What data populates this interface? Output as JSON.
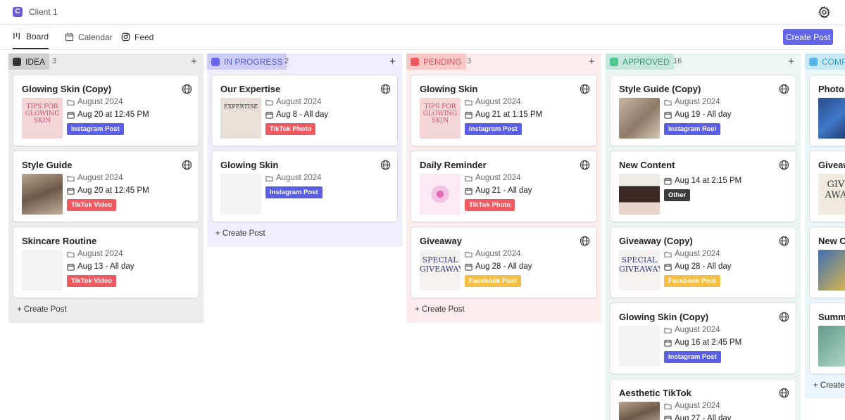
{
  "header": {
    "client_initial": "C",
    "client_name": "Client 1"
  },
  "nav": {
    "tabs": [
      {
        "label": "Board",
        "active": true
      },
      {
        "label": "Calendar",
        "active": false
      },
      {
        "label": "Feed",
        "active": false
      }
    ],
    "create_post": "Create Post"
  },
  "colors": {
    "accent": "#6366e8",
    "idea": "#333333",
    "in_progress": "#6b67e8",
    "pending": "#ee5a61",
    "approved": "#4ec894",
    "complete": "#55b7e6"
  },
  "columns": [
    {
      "title": "IDEA",
      "count": "3",
      "cards": [
        {
          "title": "Glowing Skin (Copy)",
          "folder": "August 2024",
          "date": "Aug 20 at 12:45 PM",
          "tag": "Instagram Post",
          "thumb_text": "TIPS FOR GLOWING SKIN"
        },
        {
          "title": "Style Guide",
          "folder": "August 2024",
          "date": "Aug 20 at 12:45 PM",
          "tag": "TikTok Video"
        },
        {
          "title": "Skincare Routine",
          "folder": "August 2024",
          "date": "Aug 13 - All day",
          "tag": "TikTok Video"
        }
      ],
      "create_label": "+ Create Post"
    },
    {
      "title": "IN PROGRESS",
      "count": "2",
      "cards": [
        {
          "title": "Our Expertise",
          "folder": "August 2024",
          "date": "Aug 8 - All day",
          "tag": "TikTok Photo",
          "thumb_text": "EXPERTISE"
        },
        {
          "title": "Glowing Skin",
          "folder": "August 2024",
          "tag": "Instagram Post"
        }
      ],
      "create_label": "+ Create Post"
    },
    {
      "title": "PENDING",
      "count": "3",
      "cards": [
        {
          "title": "Glowing Skin",
          "folder": "August 2024",
          "date": "Aug 21 at 1:15 PM",
          "tag": "Instagram Post",
          "thumb_text": "TIPS FOR GLOWING SKIN"
        },
        {
          "title": "Daily Reminder",
          "folder": "August 2024",
          "date": "Aug 21 - All day",
          "tag": "TikTok Photo"
        },
        {
          "title": "Giveaway",
          "folder": "August 2024",
          "date": "Aug 28 - All day",
          "tag": "Facebook Post",
          "thumb_text": "SPECIAL GIVEAWAY"
        }
      ],
      "create_label": "+ Create Post"
    },
    {
      "title": "APPROVED",
      "count": "16",
      "cards": [
        {
          "title": "Style Guide (Copy)",
          "folder": "August 2024",
          "date": "Aug 19 - All day",
          "tag": "Instagram Reel"
        },
        {
          "title": "New Content",
          "date": "Aug 14 at 2:15 PM",
          "tag": "Other"
        },
        {
          "title": "Giveaway (Copy)",
          "folder": "August 2024",
          "date": "Aug 28 - All day",
          "tag": "Facebook Post",
          "thumb_text": "SPECIAL GIVEAWAY"
        },
        {
          "title": "Glowing Skin (Copy)",
          "folder": "August 2024",
          "date": "Aug 16 at 2:45 PM",
          "tag": "Instagram Post"
        },
        {
          "title": "Aesthetic TikTok",
          "folder": "August 2024",
          "date": "Aug 27 - All day"
        }
      ]
    },
    {
      "title": "COMP",
      "cards": [
        {
          "title": "Photo D"
        },
        {
          "title": "Giveaw",
          "thumb_text": "GIV AWA"
        },
        {
          "title": "New Co"
        },
        {
          "title": "Summ"
        }
      ],
      "create_label": "+ Create"
    }
  ]
}
